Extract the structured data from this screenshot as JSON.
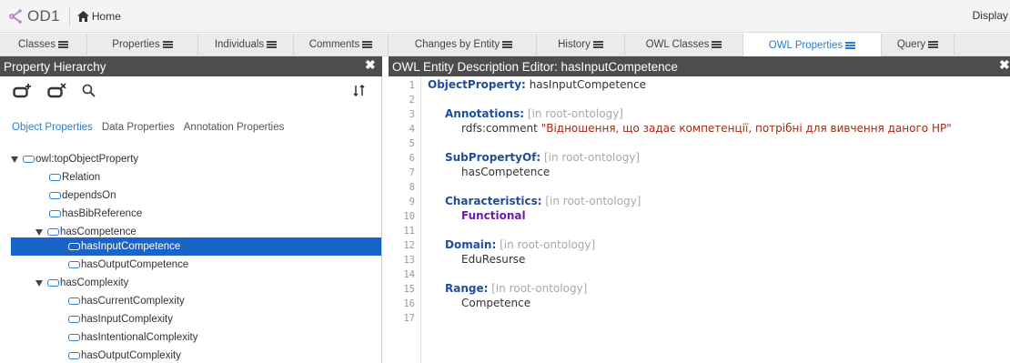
{
  "app": {
    "project_name": "OD1",
    "home_label": "Home",
    "display_label": "Display"
  },
  "tabs": [
    {
      "label": "Classes"
    },
    {
      "label": "Properties"
    },
    {
      "label": "Individuals"
    },
    {
      "label": "Comments"
    },
    {
      "label": "Changes by Entity"
    },
    {
      "label": "History"
    },
    {
      "label": "OWL Classes"
    },
    {
      "label": "OWL Properties",
      "active": true
    },
    {
      "label": "Query"
    }
  ],
  "left_panel": {
    "title": "Property Hierarchy",
    "subtabs": [
      "Object Properties",
      "Data Properties",
      "Annotation Properties"
    ],
    "active_subtab": "Object Properties",
    "tree": [
      {
        "label": "owl:topObjectProperty",
        "expanded": true
      },
      {
        "label": "Relation"
      },
      {
        "label": "dependsOn"
      },
      {
        "label": "hasBibReference"
      },
      {
        "label": "hasCompetence",
        "expanded": true
      },
      {
        "label": "hasInputCompetence",
        "selected": true
      },
      {
        "label": "hasOutputCompetence"
      },
      {
        "label": "hasComplexity",
        "expanded": true
      },
      {
        "label": "hasCurrentComplexity"
      },
      {
        "label": "hasInputComplexity"
      },
      {
        "label": "hasIntentionalComplexity"
      },
      {
        "label": "hasOutputComplexity"
      }
    ]
  },
  "editor": {
    "title": "OWL Entity Description Editor: hasInputCompetence",
    "line_numbers": [
      "1",
      "2",
      "3",
      "4",
      "5",
      "6",
      "7",
      "8",
      "9",
      "10",
      "11",
      "12",
      "13",
      "14",
      "15",
      "16",
      "17"
    ],
    "object_property_kw": "ObjectProperty:",
    "object_property_name": "hasInputCompetence",
    "annotations_kw": "Annotations:",
    "context": "[in root-ontology]",
    "comment_prop": "rdfs:comment",
    "comment_value": "\"Відношення, що задає компетенції, потрібні для вивчення даного НР\"",
    "subpropertyof_kw": "SubPropertyOf:",
    "subpropertyof_value": "hasCompetence",
    "characteristics_kw": "Characteristics:",
    "characteristics_value": "Functional",
    "domain_kw": "Domain:",
    "domain_value": "EduResurse",
    "range_kw": "Range:",
    "range_value": "Competence"
  },
  "colors": {
    "accent": "#2d7cd3",
    "selection": "#1a64c8",
    "header_bg": "#4d4d4d",
    "keyword": "#1f4d99",
    "characteristic": "#6a1ea3",
    "string": "#a32a12"
  },
  "icons": [
    "od-logo-icon",
    "home-icon",
    "add-subproperty-icon",
    "delete-property-icon",
    "search-icon",
    "sort-icon",
    "close-icon",
    "menu-icon"
  ]
}
